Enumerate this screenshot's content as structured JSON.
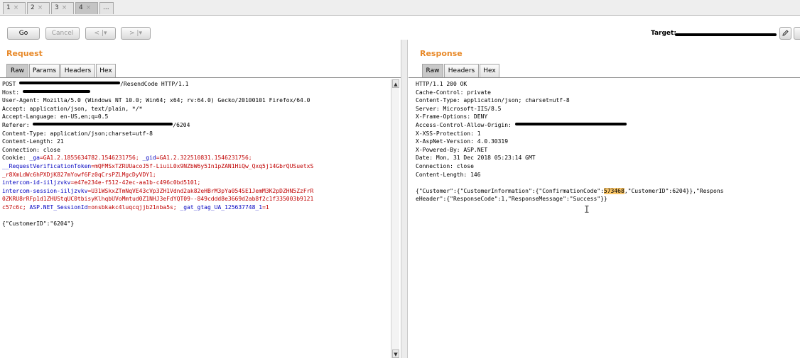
{
  "tabs": [
    {
      "label": "1",
      "close": "×"
    },
    {
      "label": "2",
      "close": "×"
    },
    {
      "label": "3",
      "close": "×"
    },
    {
      "label": "4",
      "close": "×"
    },
    {
      "label": "...",
      "close": ""
    }
  ],
  "toolbar": {
    "go_label": "Go",
    "cancel_label": "Cancel",
    "back_label": "< |▾",
    "forward_label": "> |▾",
    "target_label": "Target:"
  },
  "request": {
    "title": "Request",
    "tabs": [
      "Raw",
      "Params",
      "Headers",
      "Hex"
    ],
    "line1_method": "POST ",
    "line1_rest": "/ResendCode HTTP/1.1",
    "host": "Host: ",
    "user_agent": "User-Agent: Mozilla/5.0 (Windows NT 10.0; Win64; x64; rv:64.0) Gecko/20100101 Firefox/64.0",
    "accept": "Accept: application/json, text/plain, */*",
    "accept_language": "Accept-Language: en-US,en;q=0.5",
    "referer_key": "Referer: ",
    "referer_tail": "/6204",
    "content_type": "Content-Type: application/json;charset=utf-8",
    "content_length": "Content-Length: 21",
    "connection": "Connection: close",
    "cookie_prefix": "Cookie: ",
    "cookie_ga_key": "_ga",
    "cookie_ga_val": "=GA1.2.1855634782.1546231756; ",
    "cookie_gid_key": "_gid",
    "cookie_gid_val": "=GA1.2.322510831.1546231756;",
    "rvt_key": "__RequestVerificationToken",
    "rvt_val1": "=mQFMSxTZRUUacoJ5f-LiuiL0x9NZbW6y5In1pZAN1HiQw_Qxq5j14GbrQUSuetxS",
    "rvt_val2": "_r8XmLdWc6hPXDjK827mYowf6Fz0qCrsPZLMgcDyVDY1;",
    "icid_key": "intercom-id-iiljzvkv",
    "icid_val": "=e47e234e-f512-42ec-aa1b-c496c0bd5101;",
    "icsess_key": "intercom-session-iiljzvkv",
    "icsess_val1": "=U31WSkxZTmNqVE43cVp3ZH1Vdnd2ak82eHBrM3pYa054SE1JemM3K2pDZHN5ZzFrR",
    "icsess_val2": "0ZKRU8rRFp1d1ZHUStqUC0tbisyKlhqbUVoMmtud0Z1NHJ3eFdYQT09--849cddd8e3669d2ab8f2c1f335003b9121",
    "icsess_val3": "c57c6c; ",
    "asp_key": "ASP.NET_SessionId",
    "asp_val": "=onsbkakc4luqcqjjb21nba5s; ",
    "gat_key": "_gat_gtag_UA_125637748_1",
    "gat_val": "=1",
    "body": "{\"CustomerID\":\"6204\"}"
  },
  "response": {
    "title": "Response",
    "tabs": [
      "Raw",
      "Headers",
      "Hex"
    ],
    "lines": [
      "HTTP/1.1 200 OK",
      "Cache-Control: private",
      "Content-Type: application/json; charset=utf-8",
      "Server: Microsoft-IIS/8.5",
      "X-Frame-Options: DENY"
    ],
    "acao": "Access-Control-Allow-Origin: ",
    "lines2": [
      "X-XSS-Protection: 1",
      "X-AspNet-Version: 4.0.30319",
      "X-Powered-By: ASP.NET",
      "Date: Mon, 31 Dec 2018 05:23:14 GMT",
      "Connection: close",
      "Content-Length: 146"
    ],
    "body_a": "{\"Customer\":{\"CustomerInformation\":{\"ConfirmationCode\":",
    "body_code": "573468",
    "body_b": ",\"CustomerID\":6204}},\"Respons",
    "body_c": "eHeader\":{\"ResponseCode\":1,\"ResponseMessage\":\"Success\"}}"
  },
  "colors": {
    "accent_title": "#e88a2a",
    "cookie_key": "#0000c0",
    "cookie_value": "#c00000",
    "highlight": "#f9c66a"
  }
}
